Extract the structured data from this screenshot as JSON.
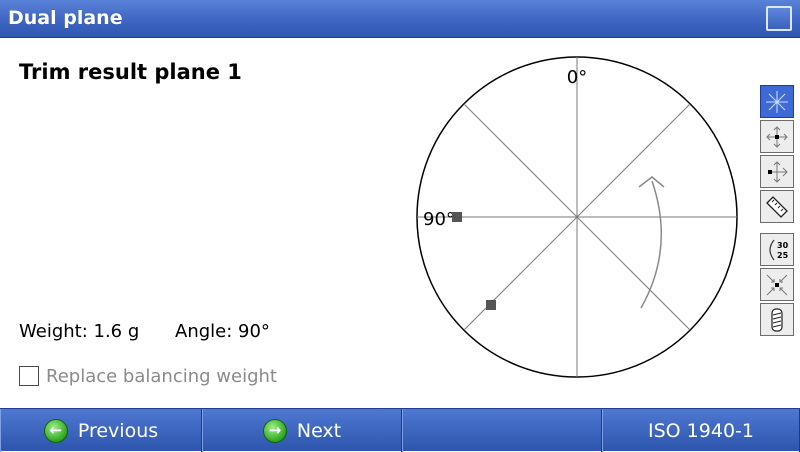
{
  "window": {
    "title": "Dual plane",
    "title_button_icon": "window-control-icon"
  },
  "main": {
    "heading": "Trim result plane 1",
    "weight_text": "Weight: 1.6 g",
    "angle_text": "Angle: 90°",
    "replace_checkbox": {
      "label": "Replace balancing weight",
      "checked": false
    }
  },
  "polar_plot": {
    "label_top": "0°",
    "label_left": "90°",
    "rotation_arrow_icon": "rotation-direction-arrow-icon",
    "markers": [
      {
        "name": "balance-weight-marker-90",
        "angle_deg": 90
      },
      {
        "name": "balance-weight-marker-135",
        "angle_deg": 135
      }
    ]
  },
  "toolbar": {
    "items": [
      {
        "name": "polar-lines-icon",
        "active": true
      },
      {
        "name": "move-all-icon",
        "active": false
      },
      {
        "name": "move-right-icon",
        "active": false
      },
      {
        "name": "ruler-icon",
        "active": false
      },
      {
        "name": "rpm-values-icon",
        "active": false,
        "text_top": "30",
        "text_bottom": "25"
      },
      {
        "name": "compress-center-icon",
        "active": false
      },
      {
        "name": "screw-weight-icon",
        "active": false
      }
    ]
  },
  "bottom_bar": {
    "previous_label": "Previous",
    "next_label": "Next",
    "standard_label": "ISO 1940-1",
    "colors": {
      "bar": "#3a62bd",
      "button_icon": "#2da51c"
    }
  }
}
